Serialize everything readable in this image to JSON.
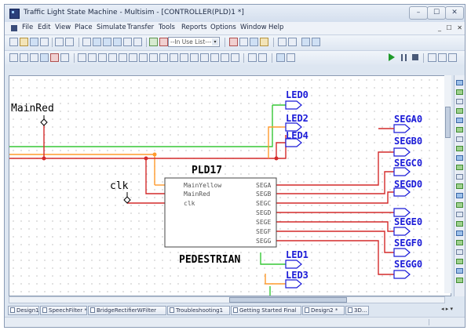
{
  "window": {
    "title": "Traffic Light State Machine - Multisim - [CONTROLLER(PLD)1 *]",
    "controls": {
      "minimize": "–",
      "maximize": "☐",
      "close": "✕"
    },
    "mdi_controls": "_ ☐ ✕"
  },
  "menu": [
    "File",
    "Edit",
    "View",
    "Place",
    "Simulate",
    "Transfer",
    "Tools",
    "Reports",
    "Options",
    "Window",
    "Help"
  ],
  "toolbar": {
    "net_dropdown_placeholder": "--In Use List---",
    "dropdown_arrow": "▾"
  },
  "schematic": {
    "input_labels": {
      "main_red": "MainRed",
      "clk": "clk"
    },
    "pld": {
      "ref": "PLD17",
      "name": "PEDESTRIAN",
      "inputs": [
        "MainYellow",
        "MainRed",
        "clk"
      ],
      "outputs": [
        "SEGA",
        "SEGB",
        "SEGC",
        "SEGD",
        "SEGE",
        "SEGF",
        "SEGG"
      ]
    },
    "led_labels": [
      "LED0",
      "LED2",
      "LED4",
      "LED1",
      "LED3"
    ],
    "seg_labels": [
      "SEGA0",
      "SEGB0",
      "SEGC0",
      "SEGD0",
      "SEGE0",
      "SEGF0",
      "SEGG0"
    ]
  },
  "tabs": [
    "Design1",
    "SpeechFilter *",
    "BridgeRectifierWFilter",
    "Troubleshooting1",
    "Getting Started Final",
    "Design2 *",
    "3D..."
  ],
  "tab_nav": "◂ ▸ ▾"
}
